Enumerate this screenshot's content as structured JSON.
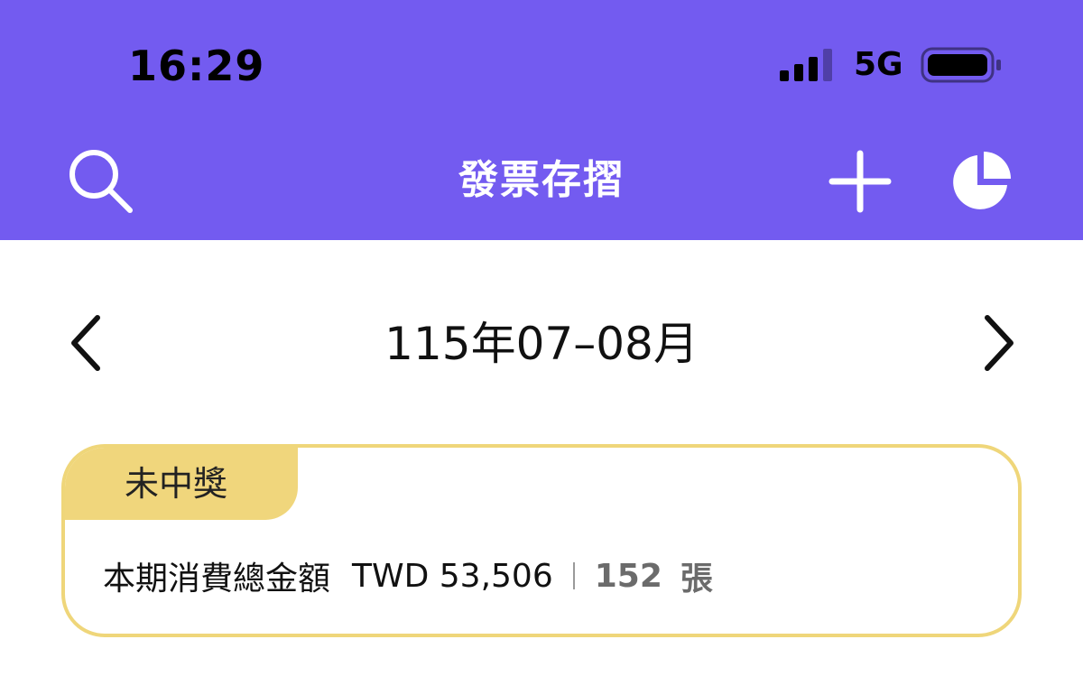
{
  "status_bar": {
    "time": "16:29",
    "network": "5G",
    "signal_icon": "signal-bars-icon",
    "battery_icon": "battery-icon"
  },
  "nav": {
    "title": "發票存摺",
    "search_icon": "search-icon",
    "add_icon": "plus-icon",
    "chart_icon": "pie-chart-icon"
  },
  "period": {
    "label": "115年07–08月",
    "prev_icon": "chevron-left-icon",
    "next_icon": "chevron-right-icon"
  },
  "summary": {
    "badge": "未中獎",
    "label": "本期消費總金額",
    "amount": "TWD 53,506",
    "count": "152",
    "unit": "張"
  },
  "colors": {
    "header": "#735BF0",
    "card_border": "#EFD67A",
    "badge": "#F0D67C"
  }
}
